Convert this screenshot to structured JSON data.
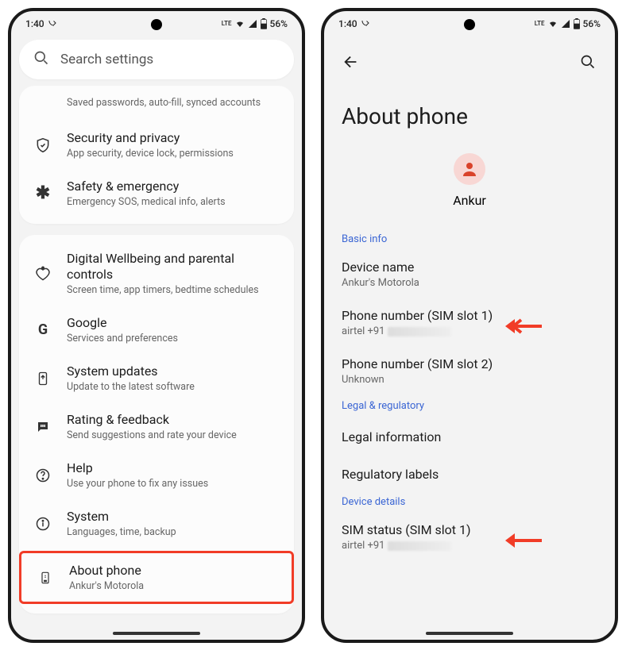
{
  "status": {
    "time": "1:40",
    "network": "LTE",
    "battery": "56%"
  },
  "left": {
    "search_placeholder": "Search settings",
    "truncated_sub": "Saved passwords, auto-fill, synced accounts",
    "card1": [
      {
        "icon": "shield-icon",
        "title": "Security and privacy",
        "sub": "App security, device lock, permissions"
      },
      {
        "icon": "asterisk-icon",
        "title": "Safety & emergency",
        "sub": "Emergency SOS, medical info, alerts"
      }
    ],
    "card2": [
      {
        "icon": "heart-icon",
        "title": "Digital Wellbeing and parental controls",
        "sub": "Screen time, app timers, bedtime schedules"
      },
      {
        "icon": "google-icon",
        "title": "Google",
        "sub": "Services and preferences"
      },
      {
        "icon": "update-icon",
        "title": "System updates",
        "sub": "Update to the latest software"
      },
      {
        "icon": "feedback-icon",
        "title": "Rating & feedback",
        "sub": "Send suggestions and rate your device"
      },
      {
        "icon": "help-icon",
        "title": "Help",
        "sub": "Use your phone to fix any issues"
      },
      {
        "icon": "info-icon",
        "title": "System",
        "sub": "Languages, time, backup"
      }
    ],
    "about_row": {
      "icon": "phone-icon",
      "title": "About phone",
      "sub": "Ankur's Motorola"
    }
  },
  "right": {
    "page_title": "About phone",
    "user_name": "Ankur",
    "section_basic": "Basic info",
    "device_name_label": "Device name",
    "device_name_value": "Ankur's Motorola",
    "sim1_label": "Phone number (SIM slot 1)",
    "sim1_prefix": "airtel +91",
    "sim2_label": "Phone number (SIM slot 2)",
    "sim2_value": "Unknown",
    "section_legal": "Legal & regulatory",
    "legal_info": "Legal information",
    "reg_labels": "Regulatory labels",
    "section_device": "Device details",
    "sim_status_label": "SIM status (SIM slot 1)",
    "sim_status_prefix": "airtel +91"
  }
}
